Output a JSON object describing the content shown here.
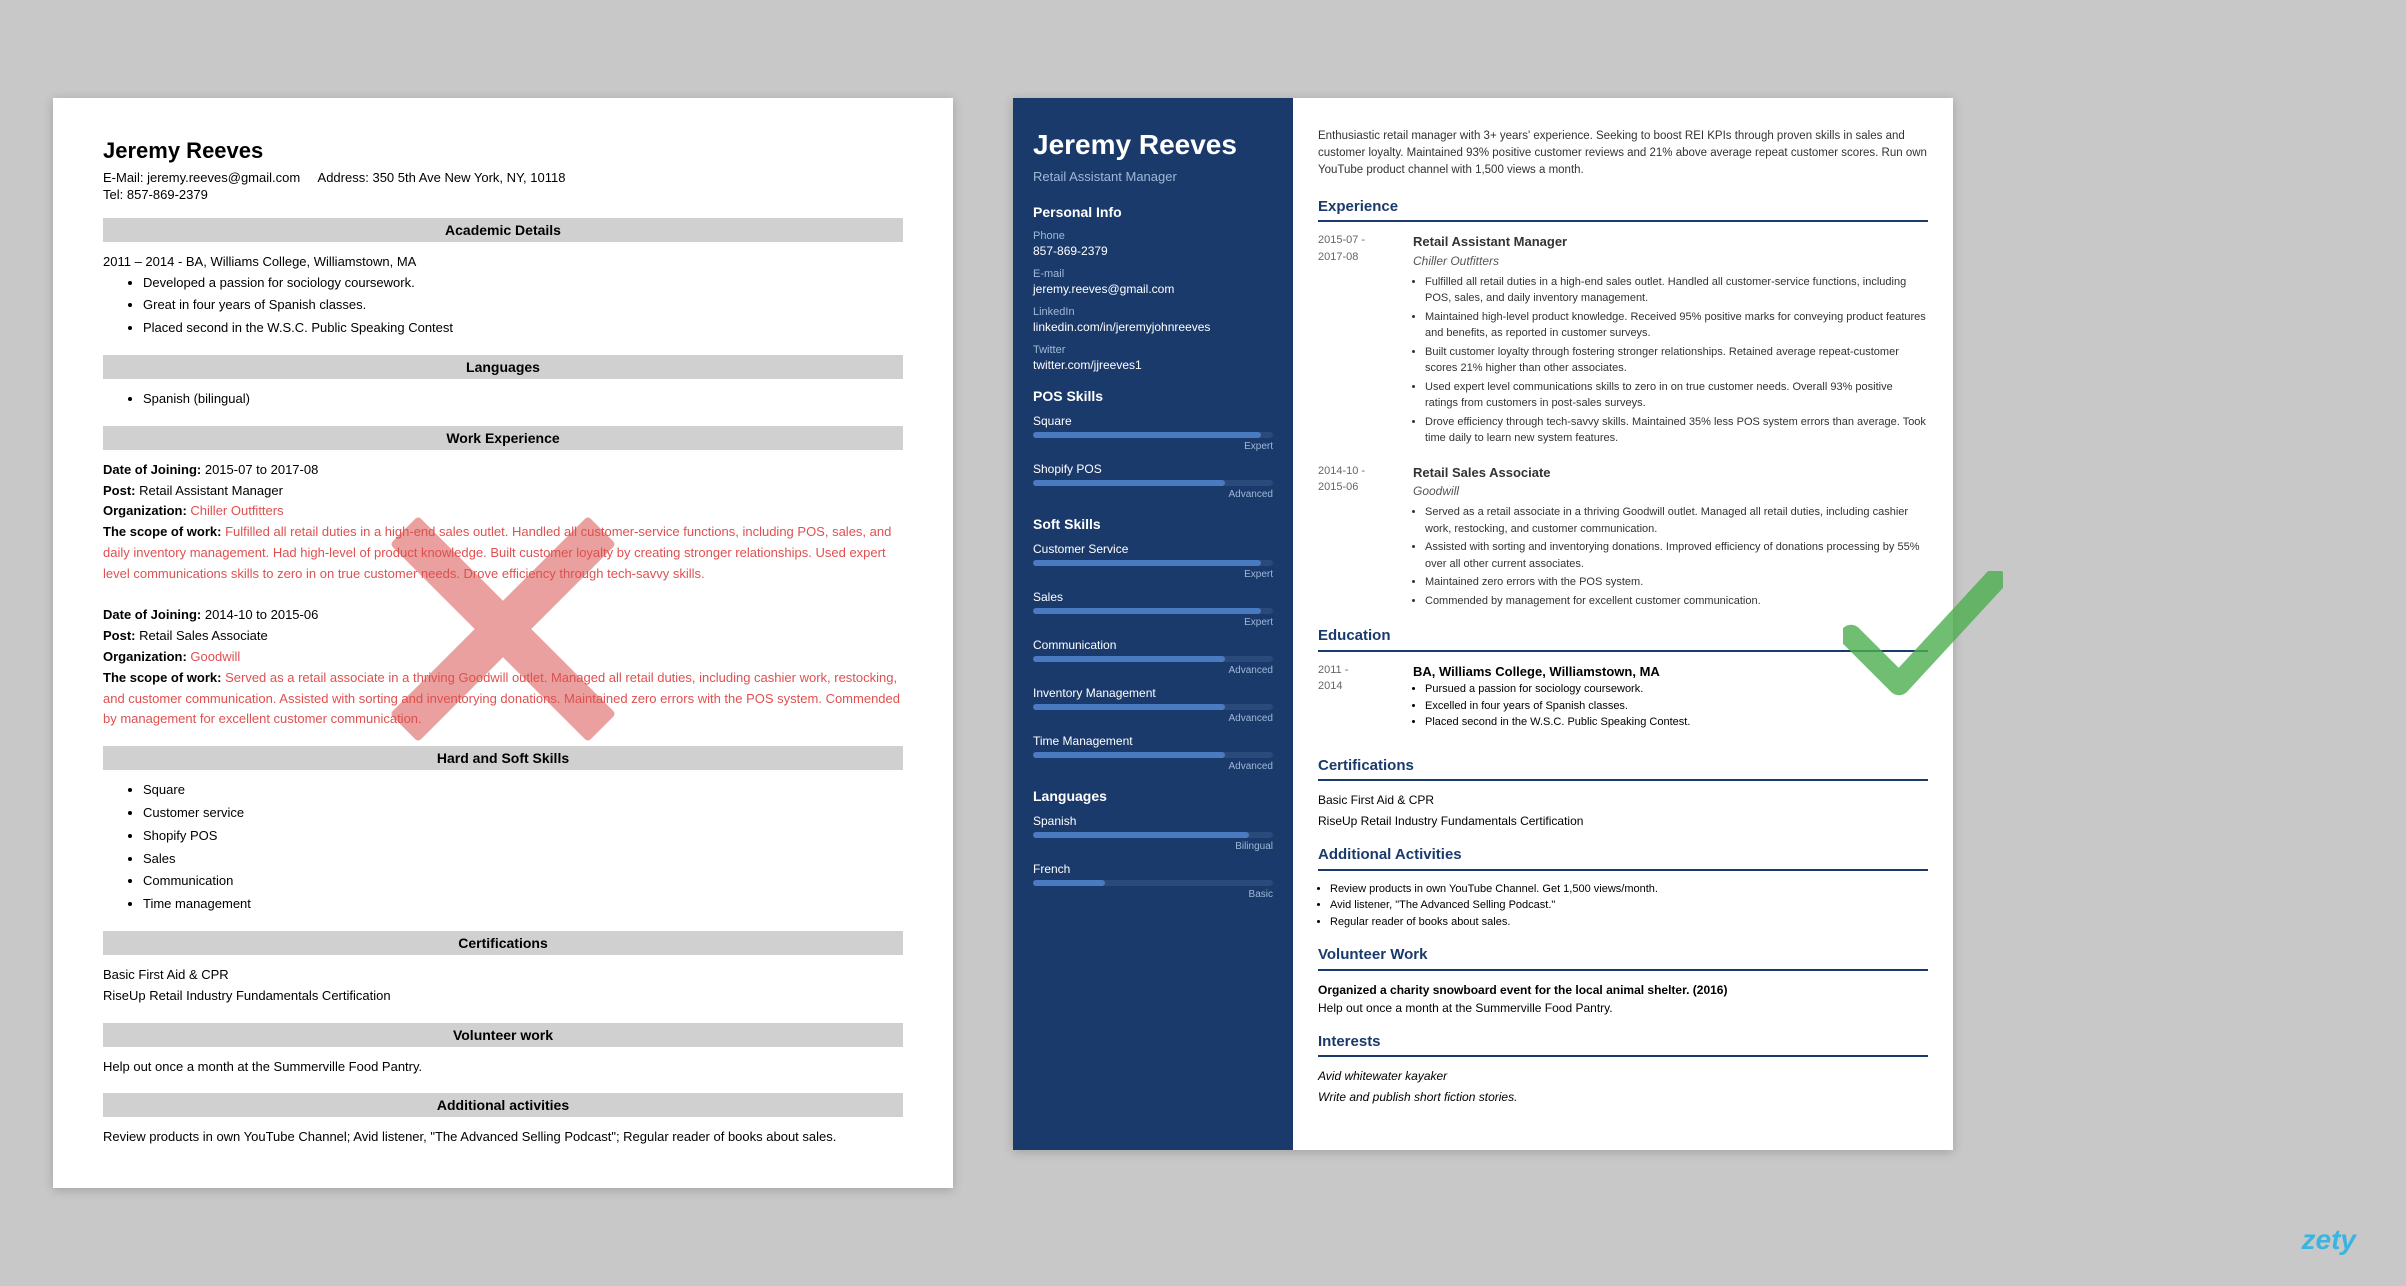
{
  "bad_resume": {
    "name": "Jeremy Reeves",
    "email_label": "E-Mail:",
    "email": "jeremy.reeves@gmail.com",
    "address_label": "Address:",
    "address": "350 5th Ave New York, NY, 10118",
    "tel_label": "Tel:",
    "tel": "857-869-2379",
    "sections": {
      "academic": "Academic Details",
      "academic_content": "2011 – 2014 - BA, Williams College, Williamstown, MA",
      "academic_bullets": [
        "Developed a passion for sociology coursework.",
        "Great in four years of Spanish classes.",
        "Placed second in the W.S.C. Public Speaking Contest"
      ],
      "languages": "Languages",
      "languages_content": "Spanish (bilingual)",
      "work": "Work Experience",
      "job1_date": "Date of Joining:",
      "job1_date_val": "2015-07 to 2017-08",
      "job1_post": "Post:",
      "job1_post_val": "Retail Assistant Manager",
      "job1_org": "Organization:",
      "job1_org_val": "Chiller Outfitters",
      "job1_scope": "The scope of work:",
      "job1_desc": "Fulfilled all retail duties in a high-end sales outlet. Handled all customer-service functions, including POS, sales, and daily inventory management. Had high-level of product knowledge. Built customer loyalty by creating stronger relationships. Used expert level communications skills to zero in on true customer needs. Drove efficiency through tech-savvy skills.",
      "job2_date": "Date of Joining:",
      "job2_date_val": "2014-10 to 2015-06",
      "job2_post": "Post:",
      "job2_post_val": "Retail Sales Associate",
      "job2_org": "Organization:",
      "job2_org_val": "Goodwill",
      "job2_scope": "The scope of work:",
      "job2_desc": "Served as a retail associate in a thriving Goodwill outlet. Managed all retail duties, including cashier work, restocking, and customer communication. Assisted with sorting and inventorying donations. Maintained zero errors with the POS system. Commended by management for excellent customer communication.",
      "skills": "Hard and Soft Skills",
      "skills_list": [
        "Square",
        "Customer service",
        "Shopify POS",
        "Sales",
        "Communication",
        "Time management"
      ],
      "certifications": "Certifications",
      "cert1": "Basic First Aid & CPR",
      "cert2": "RiseUp Retail Industry Fundamentals Certification",
      "volunteer": "Volunteer work",
      "volunteer_content": "Help out once a month at the Summerville Food Pantry.",
      "additional": "Additional activities",
      "additional_content": "Review products in own YouTube Channel; Avid listener, \"The Advanced Selling Podcast\"; Regular reader of books about sales."
    }
  },
  "good_resume": {
    "sidebar": {
      "name": "Jeremy Reeves",
      "title": "Retail Assistant Manager",
      "personal_info": "Personal Info",
      "phone_label": "Phone",
      "phone": "857-869-2379",
      "email_label": "E-mail",
      "email": "jeremy.reeves@gmail.com",
      "linkedin_label": "LinkedIn",
      "linkedin": "linkedin.com/in/jeremyjohnreeves",
      "twitter_label": "Twitter",
      "twitter": "twitter.com/jjreeves1",
      "pos_skills": "POS Skills",
      "skills_pos": [
        {
          "name": "Square",
          "level": "Expert",
          "pct": 95
        },
        {
          "name": "Shopify POS",
          "level": "Advanced",
          "pct": 80
        }
      ],
      "soft_skills": "Soft Skills",
      "skills_soft": [
        {
          "name": "Customer Service",
          "level": "Expert",
          "pct": 95
        },
        {
          "name": "Sales",
          "level": "Expert",
          "pct": 95
        },
        {
          "name": "Communication",
          "level": "Advanced",
          "pct": 80
        },
        {
          "name": "Inventory Management",
          "level": "Advanced",
          "pct": 80
        },
        {
          "name": "Time Management",
          "level": "Advanced",
          "pct": 80
        }
      ],
      "languages": "Languages",
      "langs": [
        {
          "name": "Spanish",
          "level": "Bilingual",
          "pct": 90
        },
        {
          "name": "French",
          "level": "Basic",
          "pct": 30
        }
      ]
    },
    "content": {
      "summary": "Enthusiastic retail manager with 3+ years' experience. Seeking to boost REI KPIs through proven skills in sales and customer loyalty. Maintained 93% positive customer reviews and 21% above average repeat customer scores. Run own YouTube product channel with 1,500 views a month.",
      "experience_title": "Experience",
      "jobs": [
        {
          "dates": "2015-07 -\n2017-08",
          "title": "Retail Assistant Manager",
          "company": "Chiller Outfitters",
          "bullets": [
            "Fulfilled all retail duties in a high-end sales outlet. Handled all customer-service functions, including POS, sales, and daily inventory management.",
            "Maintained high-level product knowledge. Received 95% positive marks for conveying product features and benefits, as reported in customer surveys.",
            "Built customer loyalty through fostering stronger relationships. Retained average repeat-customer scores 21% higher than other associates.",
            "Used expert level communications skills to zero in on true customer needs. Overall 93% positive ratings from customers in post-sales surveys.",
            "Drove efficiency through tech-savvy skills. Maintained 35% less POS system errors than average. Took time daily to learn new system features."
          ]
        },
        {
          "dates": "2014-10 -\n2015-06",
          "title": "Retail Sales Associate",
          "company": "Goodwill",
          "bullets": [
            "Served as a retail associate in a thriving Goodwill outlet. Managed all retail duties, including cashier work, restocking, and customer communication.",
            "Assisted with sorting and inventorying donations. Improved efficiency of donations processing by 55% over all other current associates.",
            "Maintained zero errors with the POS system.",
            "Commended by management for excellent customer communication."
          ]
        }
      ],
      "education_title": "Education",
      "education": {
        "dates": "2011 -\n2014",
        "degree": "BA, Williams College, Williamstown, MA",
        "bullets": [
          "Pursued a passion for sociology coursework.",
          "Excelled in four years of Spanish classes.",
          "Placed second in the W.S.C. Public Speaking Contest."
        ]
      },
      "certifications_title": "Certifications",
      "certs": [
        "Basic First Aid & CPR",
        "RiseUp Retail Industry Fundamentals Certification"
      ],
      "additional_title": "Additional Activities",
      "additional_bullets": [
        "Review products in own YouTube Channel. Get 1,500 views/month.",
        "Avid listener, \"The Advanced Selling Podcast.\"",
        "Regular reader of books about sales."
      ],
      "volunteer_title": "Volunteer Work",
      "volunteer_bold": "Organized a charity snowboard event for the local animal shelter. (2016)",
      "volunteer_text": "Help out once a month at the Summerville Food Pantry.",
      "interests_title": "Interests",
      "interests": [
        "Avid whitewater kayaker",
        "Write and publish short fiction stories."
      ]
    }
  },
  "watermark": "zety"
}
